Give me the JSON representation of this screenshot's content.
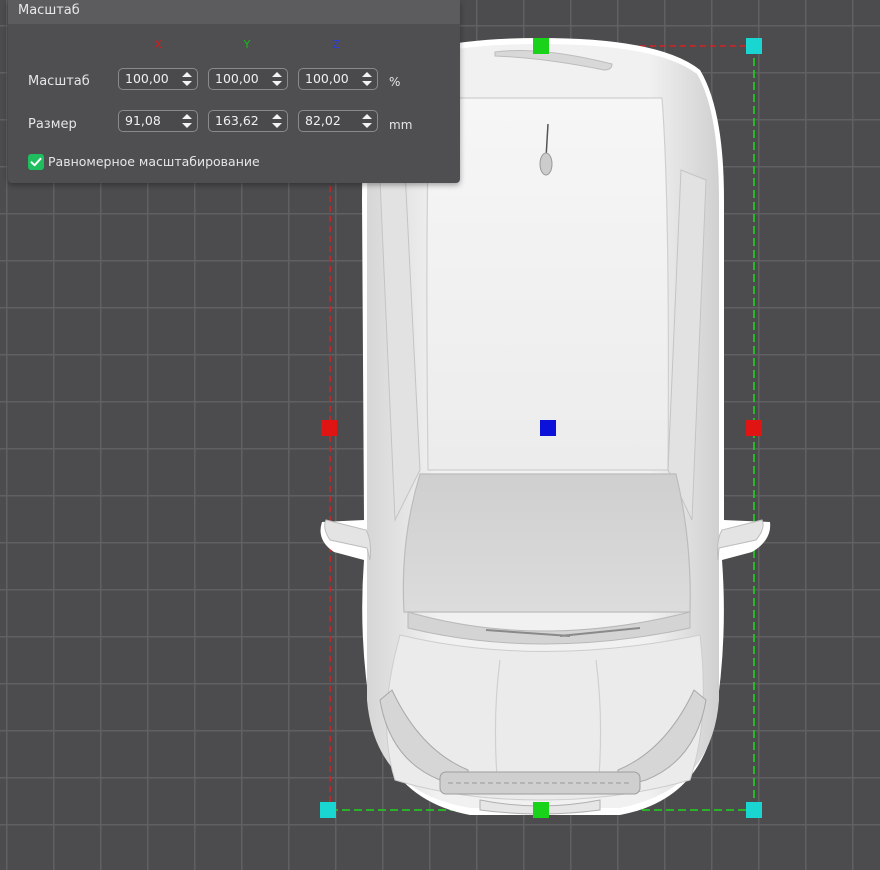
{
  "panel": {
    "title": "Масштаб",
    "axes": [
      {
        "label": "X",
        "color": "#d21c1c"
      },
      {
        "label": "Y",
        "color": "#17b917"
      },
      {
        "label": "Z",
        "color": "#2b3de0"
      }
    ],
    "scale_row": {
      "label": "Масштаб",
      "x": "100,00",
      "y": "100,00",
      "z": "100,00",
      "unit": "%"
    },
    "size_row": {
      "label": "Размер",
      "x": "91,08",
      "y": "163,62",
      "z": "82,02",
      "unit": "mm"
    },
    "uniform_scaling": {
      "label": "Равномерное масштабирование",
      "checked": true
    }
  },
  "viewport": {
    "object": "car-model-top-view",
    "gizmo_colors": {
      "x_axis": "#e11414",
      "y_axis": "#19d219",
      "corner": "#19d6d3",
      "center": "#0b11d8"
    }
  }
}
